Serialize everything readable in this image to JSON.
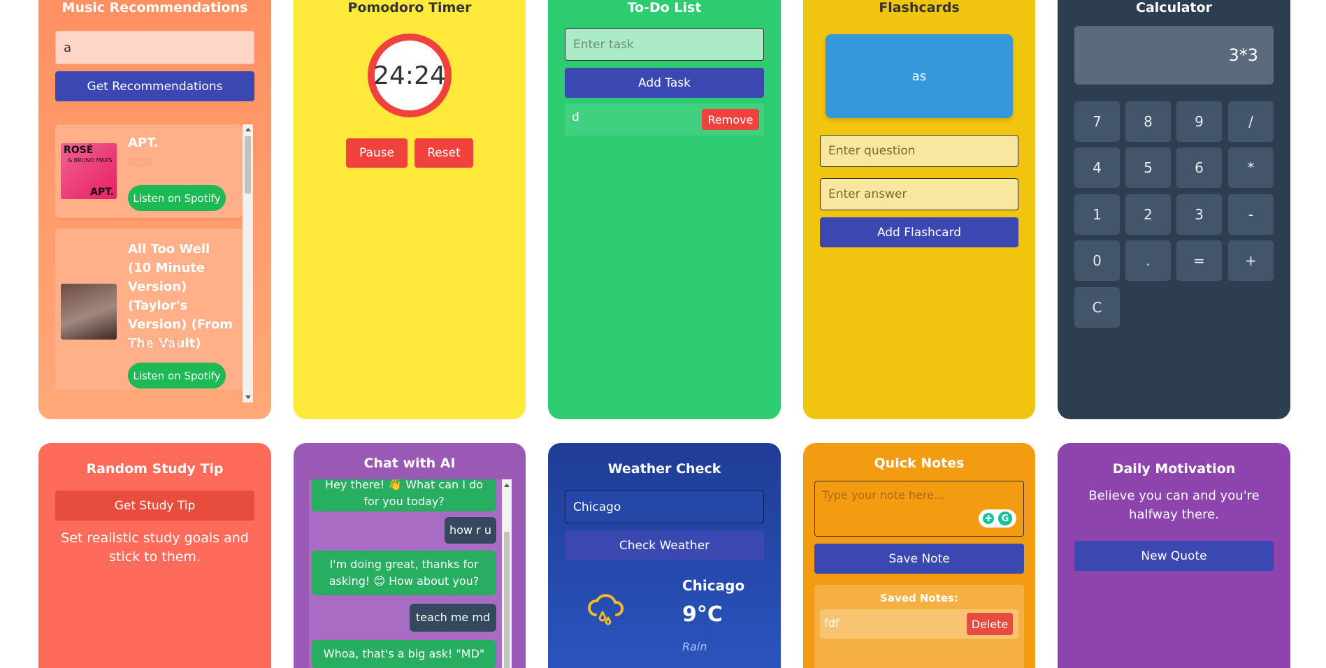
{
  "music": {
    "title": "Music Recommendations",
    "input_value": "a",
    "button": "Get Recommendations",
    "songs": [
      {
        "title": "APT.",
        "artist": "ROSÉ",
        "cover_text_top": "ROSÉ",
        "cover_text_mid": "& BRUNO MARS",
        "cover_text_bot": "APT.",
        "spotify": "Listen on Spotify"
      },
      {
        "title": "All Too Well (10 Minute Version) (Taylor's Version) (From The Vault)",
        "artist": "Taylor Swift",
        "spotify": "Listen on Spotify"
      }
    ]
  },
  "pomodoro": {
    "title": "Pomodoro Timer",
    "time": "24:24",
    "pause": "Pause",
    "reset": "Reset"
  },
  "todo": {
    "title": "To-Do List",
    "placeholder": "Enter task",
    "add": "Add Task",
    "items": [
      {
        "text": "d",
        "remove": "Remove"
      }
    ]
  },
  "flashcards": {
    "title": "Flashcards",
    "card_text": "as",
    "question_placeholder": "Enter question",
    "answer_placeholder": "Enter answer",
    "add": "Add Flashcard"
  },
  "calculator": {
    "title": "Calculator",
    "display": "3*3",
    "keys": [
      "7",
      "8",
      "9",
      "/",
      "4",
      "5",
      "6",
      "*",
      "1",
      "2",
      "3",
      "-",
      "0",
      ".",
      "=",
      "+",
      "C"
    ]
  },
  "study_tip": {
    "title": "Random Study Tip",
    "button": "Get Study Tip",
    "tip": "Set realistic study goals and stick to them."
  },
  "chat": {
    "title": "Chat with AI",
    "messages": [
      {
        "from": "ai",
        "text": "Hey there! 👋 What can I do for you today?"
      },
      {
        "from": "user",
        "text": "how r u"
      },
      {
        "from": "ai",
        "text": "I'm doing great, thanks for asking! 😊 How about you?"
      },
      {
        "from": "user",
        "text": "teach me md"
      },
      {
        "from": "ai",
        "text": "Whoa, that's a big ask! \"MD\""
      }
    ]
  },
  "weather": {
    "title": "Weather Check",
    "input_value": "Chicago",
    "button": "Check Weather",
    "city": "Chicago",
    "temp": "9°C",
    "condition": "Rain"
  },
  "notes": {
    "title": "Quick Notes",
    "placeholder": "Type your note here...",
    "save": "Save Note",
    "saved_title": "Saved Notes:",
    "items": [
      {
        "text": "fdf",
        "delete": "Delete"
      }
    ]
  },
  "motivation": {
    "title": "Daily Motivation",
    "quote": "Believe you can and you're halfway there.",
    "button": "New Quote"
  },
  "colors": {
    "music": "#ff9a6a",
    "pomodoro": "#ffe93b",
    "todo": "#2ecc71",
    "flashcards": "#f1c40f",
    "calculator": "#2c3e50",
    "study": "#ff6b5b",
    "chat": "#9b59b6",
    "weather": "#2444a8",
    "notes": "#f39c12",
    "motivation": "#8e44ad",
    "button_blue": "#3b48b2",
    "button_red": "#f0413c",
    "spotify": "#1db954"
  }
}
